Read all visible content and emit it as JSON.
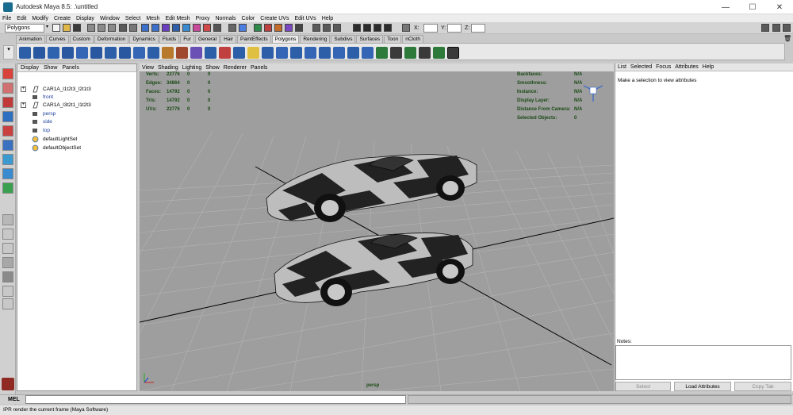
{
  "window": {
    "title": "Autodesk Maya 8.5: .\\untitled",
    "minimize": "—",
    "maximize": "☐",
    "close": "✕"
  },
  "menubar": [
    "File",
    "Edit",
    "Modify",
    "Create",
    "Display",
    "Window",
    "Select",
    "Mesh",
    "Edit Mesh",
    "Proxy",
    "Normals",
    "Color",
    "Create UVs",
    "Edit UVs",
    "Help"
  ],
  "status": {
    "mode": "Polygons",
    "x_label": "X:",
    "y_label": "Y:",
    "z_label": "Z:"
  },
  "shelf_tabs": [
    "Animation",
    "Curves",
    "Custom",
    "Deformation",
    "Dynamics",
    "Fluids",
    "Fur",
    "General",
    "Hair",
    "PaintEffects",
    "Polygons",
    "Rendering",
    "Subdivs",
    "Surfaces",
    "Toon",
    "nCloth"
  ],
  "shelf_active": "Polygons",
  "outliner": {
    "menu": [
      "Display",
      "Show",
      "Panels"
    ],
    "items": [
      {
        "label": "CAR1A_l1t2t3_l2t1t3",
        "expandable": true,
        "type": "mesh"
      },
      {
        "label": "front",
        "expandable": false,
        "type": "camera"
      },
      {
        "label": "CAR1A_l3t2t1_l1t2t3",
        "expandable": true,
        "type": "mesh"
      },
      {
        "label": "persp",
        "expandable": false,
        "type": "camera"
      },
      {
        "label": "side",
        "expandable": false,
        "type": "camera"
      },
      {
        "label": "top",
        "expandable": false,
        "type": "camera"
      },
      {
        "label": "defaultLightSet",
        "expandable": false,
        "type": "set"
      },
      {
        "label": "defaultObjectSet",
        "expandable": false,
        "type": "set"
      }
    ]
  },
  "viewport": {
    "menu": [
      "View",
      "Shading",
      "Lighting",
      "Show",
      "Renderer",
      "Panels"
    ],
    "camera_label": "persp",
    "hud_left": [
      {
        "label": "Verts:",
        "v1": "22776",
        "v2": "0",
        "v3": "0"
      },
      {
        "label": "Edges:",
        "v1": "34864",
        "v2": "0",
        "v3": "0"
      },
      {
        "label": "Faces:",
        "v1": "14792",
        "v2": "0",
        "v3": "0"
      },
      {
        "label": "Tris:",
        "v1": "14792",
        "v2": "0",
        "v3": "0"
      },
      {
        "label": "UVs:",
        "v1": "22776",
        "v2": "0",
        "v3": "0"
      }
    ],
    "hud_right": [
      {
        "label": "Backfaces:",
        "value": "N/A"
      },
      {
        "label": "Smoothness:",
        "value": "N/A"
      },
      {
        "label": "Instance:",
        "value": "N/A"
      },
      {
        "label": "Display Layer:",
        "value": "N/A"
      },
      {
        "label": "Distance From Camera:",
        "value": "N/A"
      },
      {
        "label": "Selected Objects:",
        "value": "0"
      }
    ]
  },
  "attribute_editor": {
    "menu": [
      "List",
      "Selected",
      "Focus",
      "Attributes",
      "Help"
    ],
    "message": "Make a selection to view attributes",
    "notes_label": "Notes:",
    "buttons": {
      "select": "Select",
      "load": "Load Attributes",
      "copy": "Copy Tab"
    }
  },
  "command_line": {
    "label": "MEL",
    "help": "IPR render the current frame (Maya Software)"
  },
  "colors": {
    "viewport_bg": "#9e9e9e",
    "grid": "#b4b4b4",
    "axis": "#000000",
    "hud_text": "#1a4a14",
    "car_dark": "#222222",
    "car_light": "#bdbdbd"
  }
}
